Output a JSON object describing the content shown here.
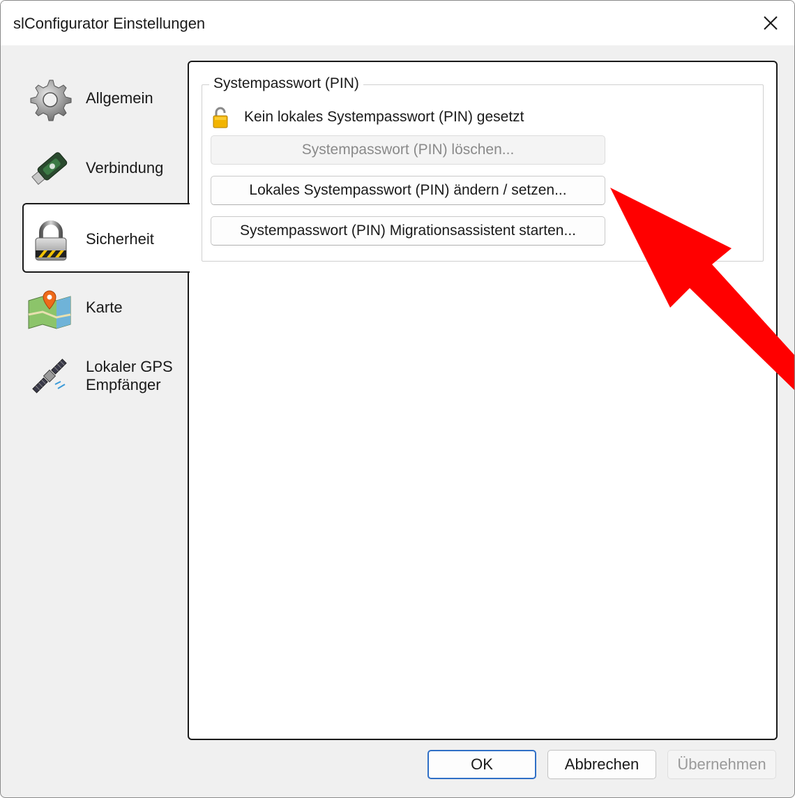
{
  "window": {
    "title": "slConfigurator Einstellungen",
    "close_icon": "close-icon"
  },
  "sidebar": {
    "items": [
      {
        "label": "Allgemein",
        "icon": "gear-icon"
      },
      {
        "label": "Verbindung",
        "icon": "usb-stick-icon"
      },
      {
        "label": "Sicherheit",
        "icon": "padlock-icon",
        "active": true
      },
      {
        "label": "Karte",
        "icon": "map-icon"
      },
      {
        "label": "Lokaler GPS\nEmpfänger",
        "line1": "Lokaler GPS",
        "line2": "Empfänger",
        "icon": "satellite-icon"
      }
    ]
  },
  "security": {
    "group_title": "Systempasswort (PIN)",
    "status_text": "Kein lokales Systempasswort (PIN) gesetzt",
    "status_icon": "open-lock-icon",
    "buttons": [
      {
        "label": "Systempasswort (PIN) löschen...",
        "enabled": false
      },
      {
        "label": "Lokales Systempasswort (PIN) ändern / setzen...",
        "enabled": true
      },
      {
        "label": "Systempasswort (PIN) Migrationsassistent starten...",
        "enabled": true
      }
    ]
  },
  "footer": {
    "ok": "OK",
    "cancel": "Abbrechen",
    "apply": "Übernehmen"
  },
  "annotation": {
    "arrow_color": "#ff0000",
    "arrow_icon": "red-arrow-annotation"
  }
}
